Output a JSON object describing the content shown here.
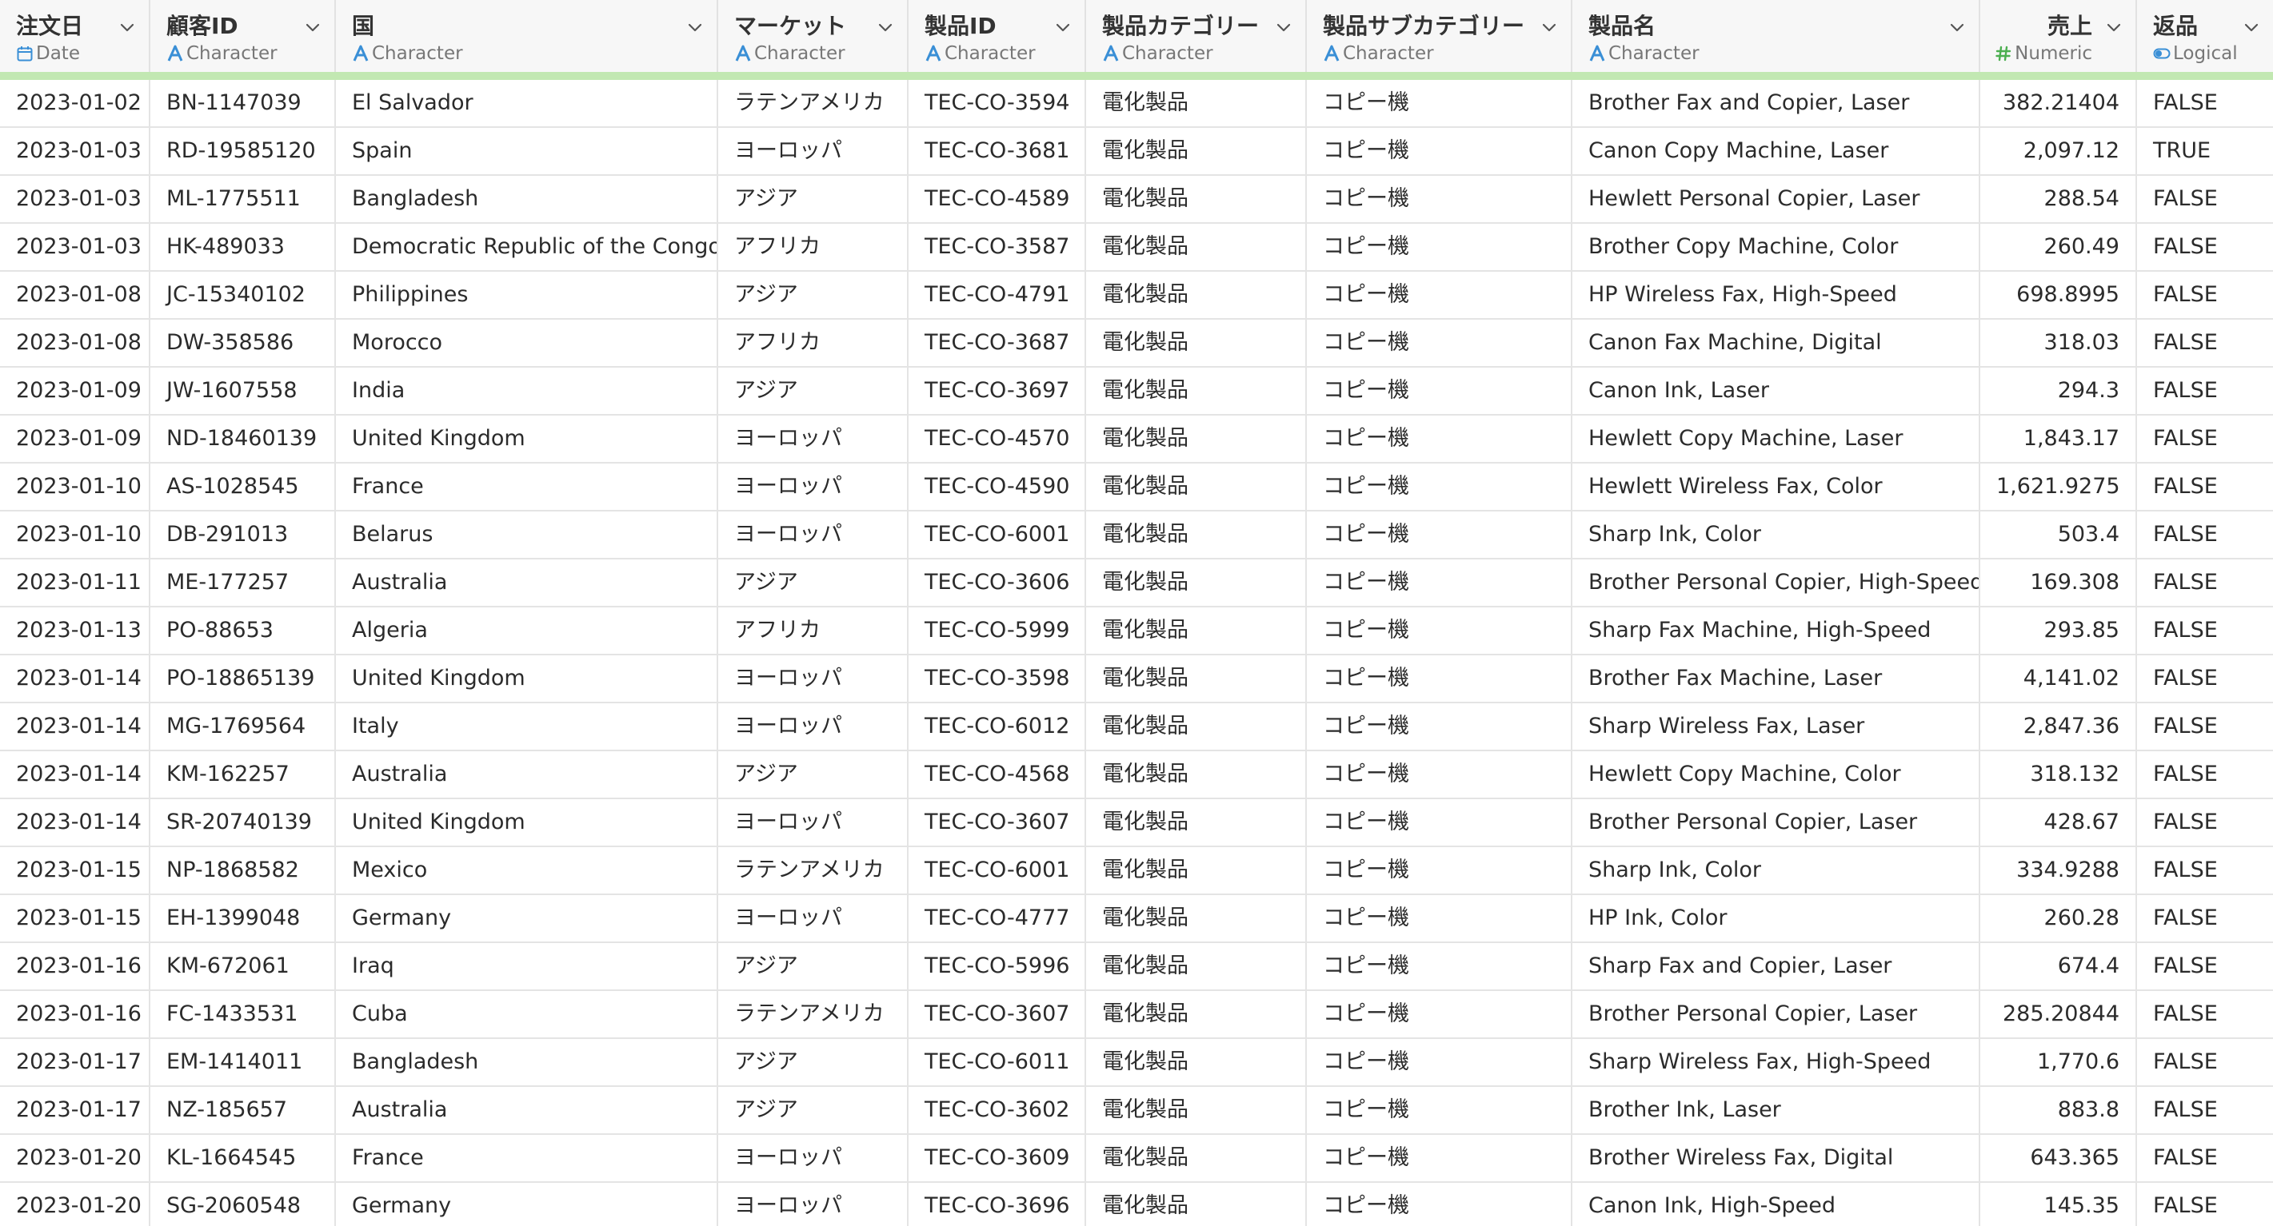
{
  "columns": [
    {
      "name": "注文日",
      "type": "Date",
      "icon": "calendar-icon",
      "align": "left"
    },
    {
      "name": "顧客ID",
      "type": "Character",
      "icon": "character-type-icon",
      "align": "left"
    },
    {
      "name": "国",
      "type": "Character",
      "icon": "character-type-icon",
      "align": "left"
    },
    {
      "name": "マーケット",
      "type": "Character",
      "icon": "character-type-icon",
      "align": "left"
    },
    {
      "name": "製品ID",
      "type": "Character",
      "icon": "character-type-icon",
      "align": "left"
    },
    {
      "name": "製品カテゴリー",
      "type": "Character",
      "icon": "character-type-icon",
      "align": "left"
    },
    {
      "name": "製品サブカテゴリー",
      "type": "Character",
      "icon": "character-type-icon",
      "align": "left"
    },
    {
      "name": "製品名",
      "type": "Character",
      "icon": "character-type-icon",
      "align": "left"
    },
    {
      "name": "売上",
      "type": "Numeric",
      "icon": "numeric-type-icon",
      "align": "right"
    },
    {
      "name": "返品",
      "type": "Logical",
      "icon": "toggle-type-icon",
      "align": "left"
    }
  ],
  "colors": {
    "date_icon": "#3a8fd6",
    "character_icon": "#3a8fd6",
    "numeric_icon": "#4caf50",
    "logical_icon": "#3a8fd6",
    "accent_bar": "#c2e8b2"
  },
  "rows": [
    [
      "2023-01-02",
      "BN-1147039",
      "El Salvador",
      "ラテンアメリカ",
      "TEC-CO-3594",
      "電化製品",
      "コピー機",
      "Brother Fax and Copier, Laser",
      "382.21404",
      "FALSE"
    ],
    [
      "2023-01-03",
      "RD-19585120",
      "Spain",
      "ヨーロッパ",
      "TEC-CO-3681",
      "電化製品",
      "コピー機",
      "Canon Copy Machine, Laser",
      "2,097.12",
      "TRUE"
    ],
    [
      "2023-01-03",
      "ML-1775511",
      "Bangladesh",
      "アジア",
      "TEC-CO-4589",
      "電化製品",
      "コピー機",
      "Hewlett Personal Copier, Laser",
      "288.54",
      "FALSE"
    ],
    [
      "2023-01-03",
      "HK-489033",
      "Democratic Republic of the Congo",
      "アフリカ",
      "TEC-CO-3587",
      "電化製品",
      "コピー機",
      "Brother Copy Machine, Color",
      "260.49",
      "FALSE"
    ],
    [
      "2023-01-08",
      "JC-15340102",
      "Philippines",
      "アジア",
      "TEC-CO-4791",
      "電化製品",
      "コピー機",
      "HP Wireless Fax, High-Speed",
      "698.8995",
      "FALSE"
    ],
    [
      "2023-01-08",
      "DW-358586",
      "Morocco",
      "アフリカ",
      "TEC-CO-3687",
      "電化製品",
      "コピー機",
      "Canon Fax Machine, Digital",
      "318.03",
      "FALSE"
    ],
    [
      "2023-01-09",
      "JW-1607558",
      "India",
      "アジア",
      "TEC-CO-3697",
      "電化製品",
      "コピー機",
      "Canon Ink, Laser",
      "294.3",
      "FALSE"
    ],
    [
      "2023-01-09",
      "ND-18460139",
      "United Kingdom",
      "ヨーロッパ",
      "TEC-CO-4570",
      "電化製品",
      "コピー機",
      "Hewlett Copy Machine, Laser",
      "1,843.17",
      "FALSE"
    ],
    [
      "2023-01-10",
      "AS-1028545",
      "France",
      "ヨーロッパ",
      "TEC-CO-4590",
      "電化製品",
      "コピー機",
      "Hewlett Wireless Fax, Color",
      "1,621.9275",
      "FALSE"
    ],
    [
      "2023-01-10",
      "DB-291013",
      "Belarus",
      "ヨーロッパ",
      "TEC-CO-6001",
      "電化製品",
      "コピー機",
      "Sharp Ink, Color",
      "503.4",
      "FALSE"
    ],
    [
      "2023-01-11",
      "ME-177257",
      "Australia",
      "アジア",
      "TEC-CO-3606",
      "電化製品",
      "コピー機",
      "Brother Personal Copier, High-Speed",
      "169.308",
      "FALSE"
    ],
    [
      "2023-01-13",
      "PO-88653",
      "Algeria",
      "アフリカ",
      "TEC-CO-5999",
      "電化製品",
      "コピー機",
      "Sharp Fax Machine, High-Speed",
      "293.85",
      "FALSE"
    ],
    [
      "2023-01-14",
      "PO-18865139",
      "United Kingdom",
      "ヨーロッパ",
      "TEC-CO-3598",
      "電化製品",
      "コピー機",
      "Brother Fax Machine, Laser",
      "4,141.02",
      "FALSE"
    ],
    [
      "2023-01-14",
      "MG-1769564",
      "Italy",
      "ヨーロッパ",
      "TEC-CO-6012",
      "電化製品",
      "コピー機",
      "Sharp Wireless Fax, Laser",
      "2,847.36",
      "FALSE"
    ],
    [
      "2023-01-14",
      "KM-162257",
      "Australia",
      "アジア",
      "TEC-CO-4568",
      "電化製品",
      "コピー機",
      "Hewlett Copy Machine, Color",
      "318.132",
      "FALSE"
    ],
    [
      "2023-01-14",
      "SR-20740139",
      "United Kingdom",
      "ヨーロッパ",
      "TEC-CO-3607",
      "電化製品",
      "コピー機",
      "Brother Personal Copier, Laser",
      "428.67",
      "FALSE"
    ],
    [
      "2023-01-15",
      "NP-1868582",
      "Mexico",
      "ラテンアメリカ",
      "TEC-CO-6001",
      "電化製品",
      "コピー機",
      "Sharp Ink, Color",
      "334.9288",
      "FALSE"
    ],
    [
      "2023-01-15",
      "EH-1399048",
      "Germany",
      "ヨーロッパ",
      "TEC-CO-4777",
      "電化製品",
      "コピー機",
      "HP Ink, Color",
      "260.28",
      "FALSE"
    ],
    [
      "2023-01-16",
      "KM-672061",
      "Iraq",
      "アジア",
      "TEC-CO-5996",
      "電化製品",
      "コピー機",
      "Sharp Fax and Copier, Laser",
      "674.4",
      "FALSE"
    ],
    [
      "2023-01-16",
      "FC-1433531",
      "Cuba",
      "ラテンアメリカ",
      "TEC-CO-3607",
      "電化製品",
      "コピー機",
      "Brother Personal Copier, Laser",
      "285.20844",
      "FALSE"
    ],
    [
      "2023-01-17",
      "EM-1414011",
      "Bangladesh",
      "アジア",
      "TEC-CO-6011",
      "電化製品",
      "コピー機",
      "Sharp Wireless Fax, High-Speed",
      "1,770.6",
      "FALSE"
    ],
    [
      "2023-01-17",
      "NZ-185657",
      "Australia",
      "アジア",
      "TEC-CO-3602",
      "電化製品",
      "コピー機",
      "Brother Ink, Laser",
      "883.8",
      "FALSE"
    ],
    [
      "2023-01-20",
      "KL-1664545",
      "France",
      "ヨーロッパ",
      "TEC-CO-3609",
      "電化製品",
      "コピー機",
      "Brother Wireless Fax, Digital",
      "643.365",
      "FALSE"
    ],
    [
      "2023-01-20",
      "SG-2060548",
      "Germany",
      "ヨーロッパ",
      "TEC-CO-3696",
      "電化製品",
      "コピー機",
      "Canon Ink, High-Speed",
      "145.35",
      "FALSE"
    ]
  ]
}
